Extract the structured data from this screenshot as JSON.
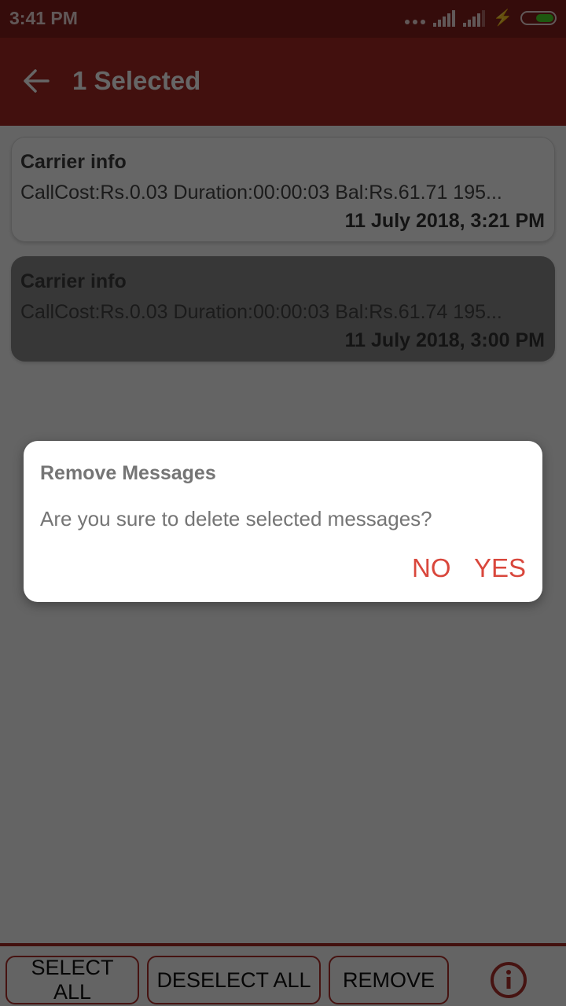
{
  "status_bar": {
    "time": "3:41 PM",
    "icons": [
      "more-dots-icon",
      "signal-icon",
      "signal-icon",
      "charging-icon",
      "battery-icon"
    ]
  },
  "app_bar": {
    "back_icon": "arrow-left-icon",
    "title": "1 Selected"
  },
  "messages": [
    {
      "sender": "Carrier info",
      "body": "CallCost:Rs.0.03 Duration:00:00:03 Bal:Rs.61.71 195...",
      "date": "11 July 2018, 3:21 PM",
      "selected": false
    },
    {
      "sender": "Carrier info",
      "body": "CallCost:Rs.0.03 Duration:00:00:03 Bal:Rs.61.74 195...",
      "date": "11 July 2018, 3:00 PM",
      "selected": true
    }
  ],
  "bottom_bar": {
    "select_all": "SELECT ALL",
    "deselect_all": "DESELECT ALL",
    "remove": "REMOVE",
    "info_icon": "info-circle-icon"
  },
  "dialog": {
    "title": "Remove Messages",
    "message": "Are you sure to delete selected messages?",
    "no_label": "NO",
    "yes_label": "YES"
  },
  "colors": {
    "primary": "#a52a24",
    "primary_dark": "#861f1c",
    "accent": "#d9473c",
    "battery": "#4ddc2a"
  }
}
